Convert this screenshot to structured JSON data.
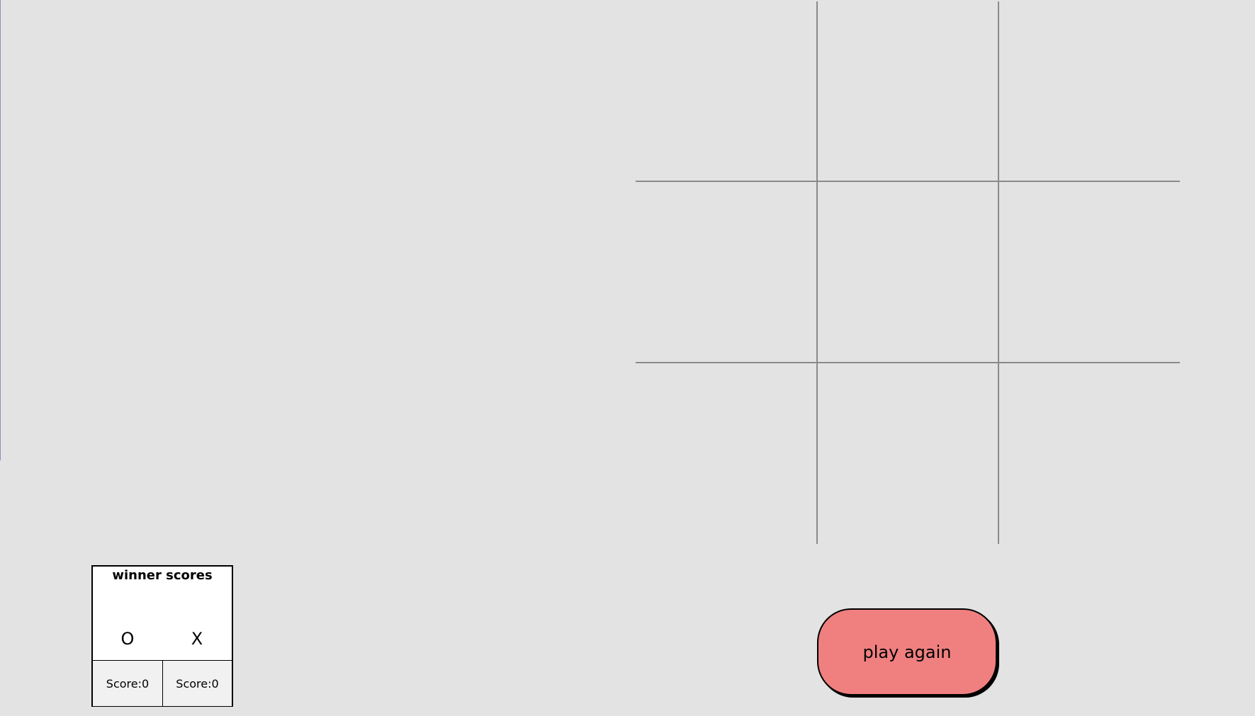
{
  "board": {
    "cells": [
      "",
      "",
      "",
      "",
      "",
      "",
      "",
      "",
      ""
    ]
  },
  "scoreboard": {
    "title": "winner scores",
    "players": [
      {
        "symbol": "O",
        "score_label": "Score:0"
      },
      {
        "symbol": "X",
        "score_label": "Score:0"
      }
    ]
  },
  "play_again": {
    "label": "play again",
    "color": "#f08080"
  },
  "colors": {
    "background": "#e3e3e3",
    "grid_line": "#8a8a8a",
    "panel": "#ffffff"
  }
}
